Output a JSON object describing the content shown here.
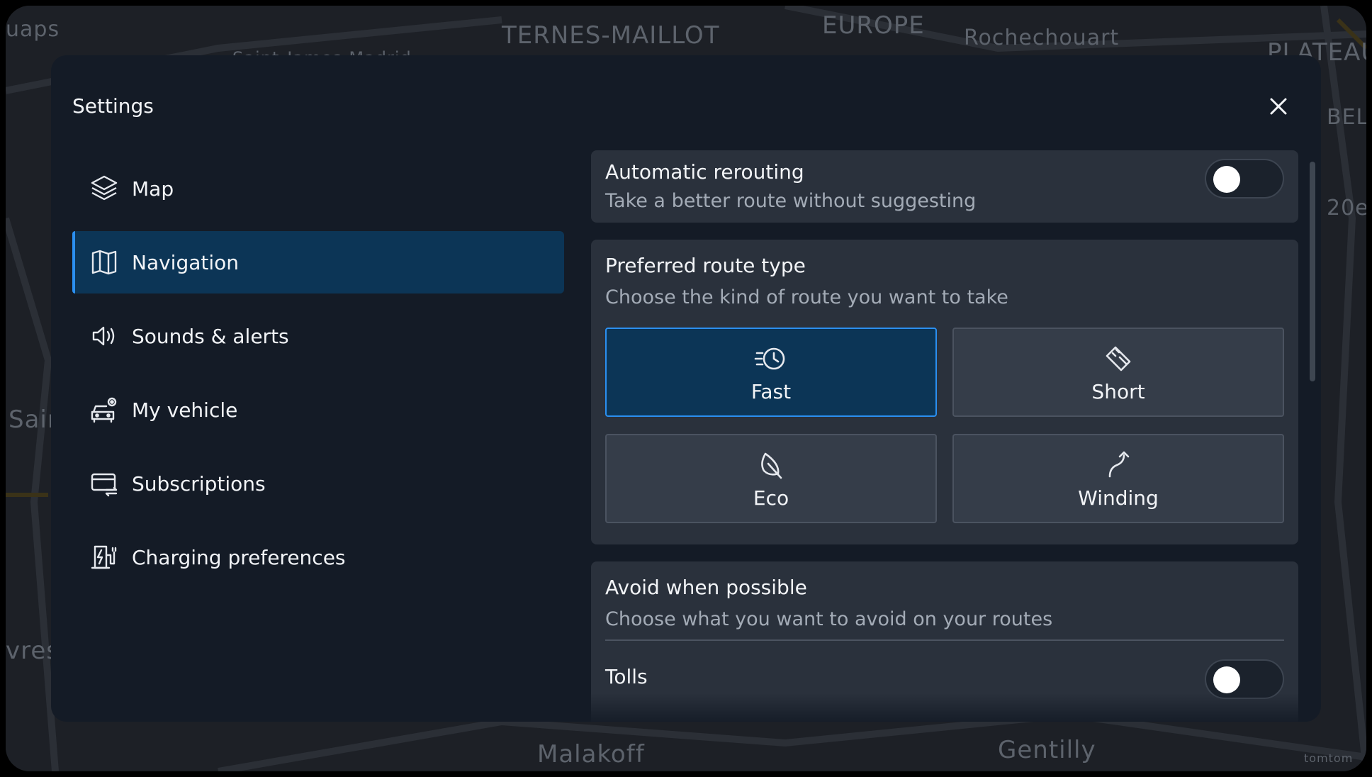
{
  "map": {
    "labels": [
      "uaps",
      "TERNES-MAILLOT",
      "Saint-James-Madrid",
      "EUROPE",
      "Rochechouart",
      "PLATEAU",
      "BEL",
      "20e",
      "Sain",
      "vres",
      "Malakoff",
      "Gentilly",
      "tomtom"
    ]
  },
  "dialog": {
    "title": "Settings",
    "close_label": "Close"
  },
  "sidebar": {
    "items": [
      {
        "label": "Map",
        "icon": "layers-icon",
        "active": false
      },
      {
        "label": "Navigation",
        "icon": "map-icon",
        "active": true
      },
      {
        "label": "Sounds & alerts",
        "icon": "speaker-icon",
        "active": false
      },
      {
        "label": "My vehicle",
        "icon": "vehicle-settings-icon",
        "active": false
      },
      {
        "label": "Subscriptions",
        "icon": "subscription-card-icon",
        "active": false
      },
      {
        "label": "Charging preferences",
        "icon": "ev-charger-icon",
        "active": false
      }
    ]
  },
  "navigation": {
    "rerouting": {
      "title": "Automatic rerouting",
      "subtitle": "Take a better route without suggesting",
      "enabled": false
    },
    "route_type": {
      "title": "Preferred route type",
      "subtitle": "Choose the kind of route you want to take",
      "options": [
        {
          "label": "Fast",
          "icon": "clock-fast-icon",
          "selected": true
        },
        {
          "label": "Short",
          "icon": "ruler-icon",
          "selected": false
        },
        {
          "label": "Eco",
          "icon": "leaf-icon",
          "selected": false
        },
        {
          "label": "Winding",
          "icon": "winding-road-icon",
          "selected": false
        }
      ]
    },
    "avoid": {
      "title": "Avoid when possible",
      "subtitle": "Choose what you want to avoid on your routes",
      "items": [
        {
          "label": "Tolls",
          "enabled": false
        }
      ]
    }
  },
  "colors": {
    "dialog_bg": "#141b26",
    "card_bg": "#2a313c",
    "accent": "#2b8ff0",
    "selected_bg": "#0c3556"
  }
}
